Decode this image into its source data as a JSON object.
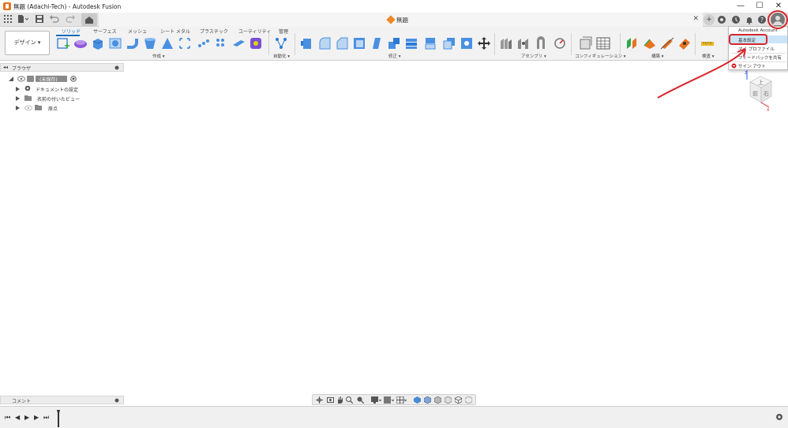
{
  "window": {
    "title": "無題 (Adachi-Tech) - Autodesk Fusion",
    "minimize": "—",
    "maximize": "☐",
    "close": "✕"
  },
  "quick_access": {
    "grid_icon": "grid-icon",
    "file_icon": "file-icon",
    "save_icon": "save-icon",
    "undo_icon": "undo-icon",
    "redo_icon": "redo-icon",
    "home_icon": "home-icon"
  },
  "document_tab": {
    "name": "無題",
    "close": "✕"
  },
  "top_right": {
    "new_tab": "+",
    "help": "?"
  },
  "ribbon": {
    "workspace": "デザイン ▾",
    "tabs": [
      {
        "label": "ソリッド",
        "active": true
      },
      {
        "label": "サーフェス",
        "active": false
      },
      {
        "label": "メッシュ",
        "active": false
      },
      {
        "label": "シート メタル",
        "active": false
      },
      {
        "label": "プラスチック",
        "active": false
      },
      {
        "label": "ユーティリティ",
        "active": false
      },
      {
        "label": "管理",
        "active": false
      }
    ],
    "groups": {
      "create": "作成 ▾",
      "automate": "自動化 ▾",
      "modify": "修正 ▾",
      "assemble": "アセンブリ ▾",
      "configure": "コンフィギュレーション ▾",
      "construct": "構築 ▾",
      "inspect": "検査 ▾"
    }
  },
  "user_menu": {
    "items": [
      {
        "label": "Autodesk Account"
      },
      {
        "label": "基本設定"
      },
      {
        "label": "マイ プロファイル"
      },
      {
        "label": "フィードバックを共有"
      },
      {
        "label": "サイン アウト"
      }
    ]
  },
  "browser": {
    "header": "ブラウザ",
    "collapse": "◂◂",
    "root": "(未保存)",
    "items": [
      {
        "label": "ドキュメントの設定"
      },
      {
        "label": "名前の付いたビュー"
      },
      {
        "label": "原点"
      }
    ]
  },
  "viewcube": {
    "top": "上",
    "front": "前",
    "right": "右",
    "axis_x": "X",
    "axis_z": "Z"
  },
  "comments": {
    "label": "コメント"
  },
  "timeline": {
    "first": "⏮",
    "prev": "◀",
    "play": "▶",
    "next": "▶",
    "last": "⏭"
  },
  "colors": {
    "accent": "#0f6cbd",
    "annotation": "#d7262b",
    "brand": "#e8731f"
  }
}
